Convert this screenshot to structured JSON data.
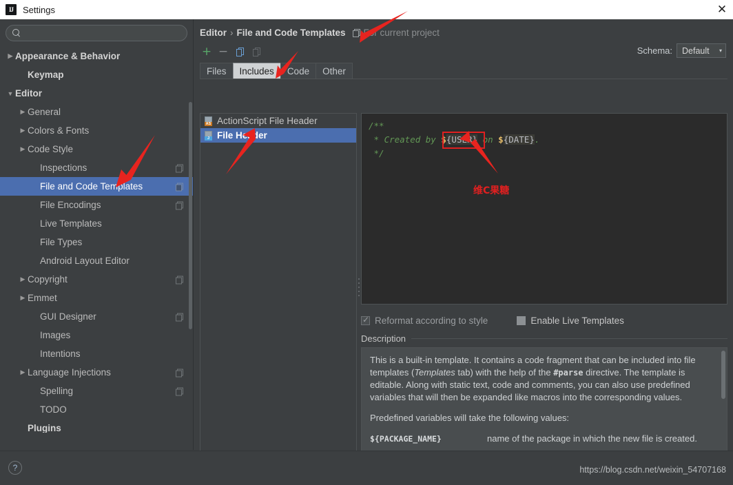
{
  "window": {
    "title": "Settings",
    "logo": "intellij-idea-logo",
    "close_label": "✕"
  },
  "search": {
    "value": "",
    "placeholder": "",
    "icon": "search-icon"
  },
  "sidebar": {
    "items": [
      {
        "label": "Appearance & Behavior",
        "twisty": "▶",
        "bold": true,
        "selected": false,
        "badge": false,
        "indent": 0
      },
      {
        "label": "Keymap",
        "twisty": "",
        "bold": true,
        "selected": false,
        "badge": false,
        "indent": 1
      },
      {
        "label": "Editor",
        "twisty": "▼",
        "bold": true,
        "selected": false,
        "badge": false,
        "indent": 0
      },
      {
        "label": "General",
        "twisty": "▶",
        "bold": false,
        "selected": false,
        "badge": false,
        "indent": 1
      },
      {
        "label": "Colors & Fonts",
        "twisty": "▶",
        "bold": false,
        "selected": false,
        "badge": false,
        "indent": 1
      },
      {
        "label": "Code Style",
        "twisty": "▶",
        "bold": false,
        "selected": false,
        "badge": false,
        "indent": 1
      },
      {
        "label": "Inspections",
        "twisty": "",
        "bold": false,
        "selected": false,
        "badge": true,
        "indent": 2
      },
      {
        "label": "File and Code Templates",
        "twisty": "",
        "bold": false,
        "selected": true,
        "badge": true,
        "indent": 2
      },
      {
        "label": "File Encodings",
        "twisty": "",
        "bold": false,
        "selected": false,
        "badge": true,
        "indent": 2
      },
      {
        "label": "Live Templates",
        "twisty": "",
        "bold": false,
        "selected": false,
        "badge": false,
        "indent": 2
      },
      {
        "label": "File Types",
        "twisty": "",
        "bold": false,
        "selected": false,
        "badge": false,
        "indent": 2
      },
      {
        "label": "Android Layout Editor",
        "twisty": "",
        "bold": false,
        "selected": false,
        "badge": false,
        "indent": 2
      },
      {
        "label": "Copyright",
        "twisty": "▶",
        "bold": false,
        "selected": false,
        "badge": true,
        "indent": 1
      },
      {
        "label": "Emmet",
        "twisty": "▶",
        "bold": false,
        "selected": false,
        "badge": false,
        "indent": 1
      },
      {
        "label": "GUI Designer",
        "twisty": "",
        "bold": false,
        "selected": false,
        "badge": true,
        "indent": 2
      },
      {
        "label": "Images",
        "twisty": "",
        "bold": false,
        "selected": false,
        "badge": false,
        "indent": 2
      },
      {
        "label": "Intentions",
        "twisty": "",
        "bold": false,
        "selected": false,
        "badge": false,
        "indent": 2
      },
      {
        "label": "Language Injections",
        "twisty": "▶",
        "bold": false,
        "selected": false,
        "badge": true,
        "indent": 1
      },
      {
        "label": "Spelling",
        "twisty": "",
        "bold": false,
        "selected": false,
        "badge": true,
        "indent": 2
      },
      {
        "label": "TODO",
        "twisty": "",
        "bold": false,
        "selected": false,
        "badge": false,
        "indent": 2
      },
      {
        "label": "Plugins",
        "twisty": "",
        "bold": true,
        "selected": false,
        "badge": false,
        "indent": 1
      }
    ]
  },
  "header": {
    "breadcrumb_root": "Editor",
    "separator": "›",
    "breadcrumb_current": "File and Code Templates",
    "scope_note": "For current project",
    "scope_icon": "project-scope-icon"
  },
  "toolbar": {
    "add_label": "+",
    "remove_label": "−",
    "copy_icon": "copy-template-icon",
    "reset_icon": "reset-template-icon",
    "schema_label": "Schema:",
    "schema_value": "Default",
    "schema_caret": "▾"
  },
  "tabs": [
    {
      "label": "Files",
      "active": false
    },
    {
      "label": "Includes",
      "active": true
    },
    {
      "label": "Code",
      "active": false
    },
    {
      "label": "Other",
      "active": false
    }
  ],
  "template_list": [
    {
      "label": "ActionScript File Header",
      "icon_kind": "as",
      "icon_text": "AS",
      "selected": false
    },
    {
      "label": "File Header",
      "icon_kind": "java",
      "icon_text": "J",
      "selected": true
    }
  ],
  "editor": {
    "line1": "/**",
    "line2_prefix": " * Created by ",
    "line2_dollar1": "$",
    "line2_var1": "{USER}",
    "line2_mid": " on ",
    "line2_dollar2": "$",
    "line2_var2": "{DATE}",
    "line2_suffix": ".",
    "line3": " */"
  },
  "options": {
    "reformat_label": "Reformat according to style",
    "reformat_checked": true,
    "live_templates_label": "Enable Live Templates",
    "live_templates_checked": false
  },
  "description": {
    "title": "Description",
    "p1_a": "This is a built-in template. It contains a code fragment that can be included into file templates (",
    "p1_em": "Templates",
    "p1_b": " tab) with the help of the ",
    "p1_mono": "#parse",
    "p1_c": " directive. The template is editable. Along with static text, code and comments, you can also use predefined variables that will then be expanded like macros into the corresponding values.",
    "p2": "Predefined variables will take the following values:",
    "var_name": "${PACKAGE_NAME}",
    "var_desc": "name of the package in which the new file is created."
  },
  "footer": {
    "help_label": "?",
    "watermark": "https://blog.csdn.net/weixin_54707168"
  },
  "annotations": {
    "callout_text": "维C果糖",
    "arrow_color": "#e8241f",
    "highlight_color": "#e02020"
  }
}
